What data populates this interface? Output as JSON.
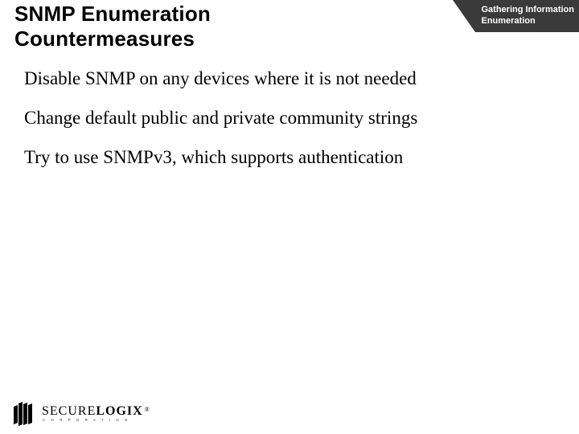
{
  "header": {
    "title_line1": "SNMP Enumeration",
    "title_line2": "Countermeasures",
    "corner_line1": "Gathering Information",
    "corner_line2": "Enumeration"
  },
  "bullets": {
    "b0": "Disable SNMP on any devices where it is not needed",
    "b1": "Change default public and private community strings",
    "b2": "Try to use SNMPv3, which supports authentication"
  },
  "footer": {
    "brand_first": "SECURE",
    "brand_second": "LOGIX",
    "reg": "®",
    "sub": "C O R P O R A T I O N"
  }
}
